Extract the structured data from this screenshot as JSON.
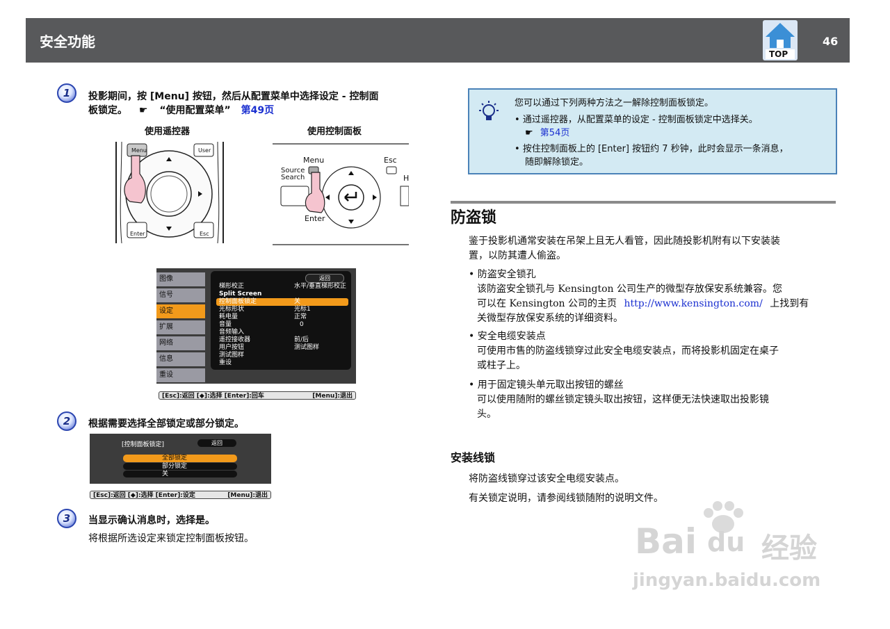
{
  "header": {
    "title": "安全功能",
    "top_label": "TOP",
    "page_number": "46"
  },
  "steps": [
    {
      "number": "1",
      "text_line1": "投影期间，按 [Menu] 按钮，然后从配置菜单中选择设定 - 控制面",
      "text_line2_prefix": "板锁定。",
      "pointer": "☛",
      "ref_text": "“使用配置菜单”",
      "ref_link": "第49页",
      "caption_remote": "使用遥控器",
      "caption_panel": "使用控制面板"
    },
    {
      "number": "2",
      "text": "根据需要选择全部锁定或部分锁定。"
    },
    {
      "number": "3",
      "text": "当显示确认消息时，选择是。",
      "sub_text": "将根据所选设定来锁定控制面板按钮。"
    }
  ],
  "remote": {
    "menu_label": "Menu",
    "user_label": "User",
    "enter_label": "Enter",
    "esc_label": "Esc"
  },
  "panel": {
    "menu_label": "Menu",
    "esc_label": "Esc",
    "source_label": "Source",
    "search_label": "Search",
    "enter_label": "Enter",
    "h_label": "H"
  },
  "config_menu": {
    "tabs": [
      "图像",
      "信号",
      "设定",
      "扩展",
      "网络",
      "信息",
      "重设"
    ],
    "active_tab_index": 2,
    "return_label": "返回",
    "rows": [
      {
        "label": "梯形校正",
        "value": "水平/垂直梯形校正"
      },
      {
        "label": "Split Screen",
        "value": ""
      },
      {
        "label": "控制面板锁定",
        "value": "关"
      },
      {
        "label": "光标形状",
        "value": "光标1"
      },
      {
        "label": "耗电量",
        "value": "正常"
      },
      {
        "label": "音量",
        "value": "0"
      },
      {
        "label": "音频输入",
        "value": ""
      },
      {
        "label": "遥控接收器",
        "value": "前/后"
      },
      {
        "label": "用户按钮",
        "value": "测试图样"
      },
      {
        "label": "测试图样",
        "value": ""
      },
      {
        "label": "重设",
        "value": ""
      }
    ],
    "footer_left": "[Esc]:返回 [◆]:选择 [Enter]:回车",
    "footer_right": "[Menu]:退出"
  },
  "lock_menu": {
    "title": "[控制面板锁定]",
    "return_label": "返回",
    "options": [
      "全部锁定",
      "部分锁定",
      "关"
    ],
    "footer_left": "[Esc]:返回 [◆]:选择 [Enter]:设定",
    "footer_right": "[Menu]:退出"
  },
  "tip": {
    "intro": "您可以通过下列两种方法之一解除控制面板锁定。",
    "bullet1": "通过遥控器，从配置菜单的设定 - 控制面板锁定中选择关。",
    "bullet1_pointer": "☛",
    "bullet1_link": "第54页",
    "bullet2_line1": "按住控制面板上的 [Enter] 按钮约 7 秒钟，此时会显示一条消息，",
    "bullet2_line2": "随即解除锁定。"
  },
  "section": {
    "title": "防盗锁",
    "intro_line1": "鉴于投影机通常安装在吊架上且无人看管，因此随投影机附有以下安装装",
    "intro_line2": "置，以防其遭人偷盗。",
    "items": [
      {
        "title": "防盗安全锁孔",
        "line1": "该防盗安全锁孔与 Kensington 公司生产的微型存放保安系统兼容。您",
        "line2_prefix": "可以在 Kensington 公司的主页",
        "line2_link": "http://www.kensington.com/",
        "line2_suffix": "上找到有",
        "line3": "关微型存放保安系统的详细资料。"
      },
      {
        "title": "安全电缆安装点",
        "line1": "可使用市售的防盗线锁穿过此安全电缆安装点，而将投影机固定在桌子",
        "line2": "或柱子上。"
      },
      {
        "title": "用于固定镜头单元取出按钮的螺丝",
        "line1": "可以使用随附的螺丝锁定镜头取出按钮，这样便无法快速取出投影镜",
        "line2": "头。"
      }
    ],
    "subsection_title": "安装线锁",
    "sub_line1": "将防盗线锁穿过该安全电缆安装点。",
    "sub_line2": "有关锁定说明，请参阅线锁随附的说明文件。"
  },
  "watermark": {
    "brand": "Bai",
    "brand2": "du",
    "brand3": "经验",
    "url": "jingyan.baidu.com"
  },
  "colors": {
    "header_bg": "#58595b",
    "link": "#1a2fd0",
    "tip_bg": "#d3eaf3",
    "tip_border": "#4a82b8",
    "menu_highlight": "#f29a1b"
  }
}
